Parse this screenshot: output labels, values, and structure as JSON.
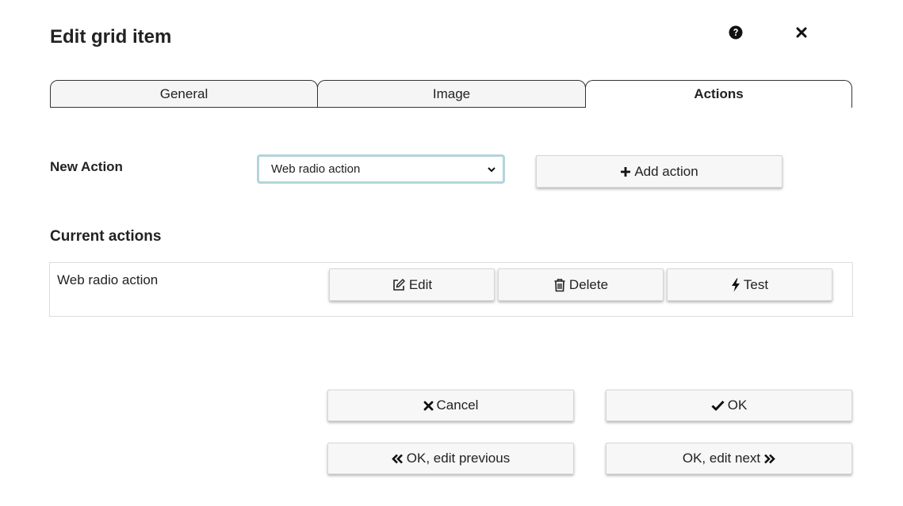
{
  "dialog": {
    "title": "Edit grid item"
  },
  "tabs": [
    {
      "label": "General",
      "active": false
    },
    {
      "label": "Image",
      "active": false
    },
    {
      "label": "Actions",
      "active": true
    }
  ],
  "new_action": {
    "label": "New Action",
    "selected": "Web radio action",
    "add_label": "Add action"
  },
  "current_actions": {
    "heading": "Current actions",
    "items": [
      {
        "name": "Web radio action",
        "edit_label": "Edit",
        "delete_label": "Delete",
        "test_label": "Test"
      }
    ]
  },
  "footer": {
    "cancel_label": "Cancel",
    "ok_label": "OK",
    "prev_label": "OK, edit previous",
    "next_label": "OK, edit next"
  },
  "icons": {
    "help": "question-circle-icon",
    "close": "close-icon",
    "add": "plus-icon",
    "edit": "pencil-square-icon",
    "delete": "trash-icon",
    "test": "bolt-icon",
    "cancel": "times-icon",
    "ok": "check-icon",
    "prev": "double-chevron-left-icon",
    "next": "double-chevron-right-icon"
  },
  "colors": {
    "select_border": "#b3d4dc",
    "button_bg": "#f7f7f7",
    "text": "#222222"
  }
}
